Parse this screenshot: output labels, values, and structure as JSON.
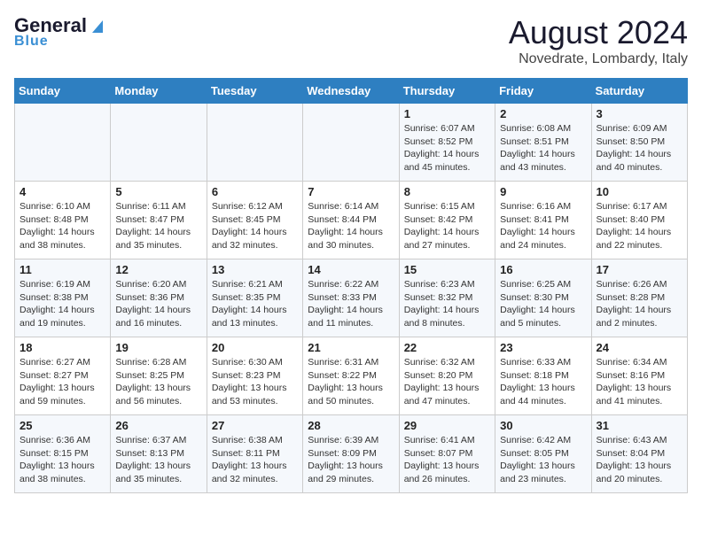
{
  "header": {
    "logo_general": "General",
    "logo_blue": "Blue",
    "title": "August 2024",
    "subtitle": "Novedrate, Lombardy, Italy"
  },
  "days_of_week": [
    "Sunday",
    "Monday",
    "Tuesday",
    "Wednesday",
    "Thursday",
    "Friday",
    "Saturday"
  ],
  "weeks": [
    [
      {
        "day": "",
        "info": ""
      },
      {
        "day": "",
        "info": ""
      },
      {
        "day": "",
        "info": ""
      },
      {
        "day": "",
        "info": ""
      },
      {
        "day": "1",
        "info": "Sunrise: 6:07 AM\nSunset: 8:52 PM\nDaylight: 14 hours\nand 45 minutes."
      },
      {
        "day": "2",
        "info": "Sunrise: 6:08 AM\nSunset: 8:51 PM\nDaylight: 14 hours\nand 43 minutes."
      },
      {
        "day": "3",
        "info": "Sunrise: 6:09 AM\nSunset: 8:50 PM\nDaylight: 14 hours\nand 40 minutes."
      }
    ],
    [
      {
        "day": "4",
        "info": "Sunrise: 6:10 AM\nSunset: 8:48 PM\nDaylight: 14 hours\nand 38 minutes."
      },
      {
        "day": "5",
        "info": "Sunrise: 6:11 AM\nSunset: 8:47 PM\nDaylight: 14 hours\nand 35 minutes."
      },
      {
        "day": "6",
        "info": "Sunrise: 6:12 AM\nSunset: 8:45 PM\nDaylight: 14 hours\nand 32 minutes."
      },
      {
        "day": "7",
        "info": "Sunrise: 6:14 AM\nSunset: 8:44 PM\nDaylight: 14 hours\nand 30 minutes."
      },
      {
        "day": "8",
        "info": "Sunrise: 6:15 AM\nSunset: 8:42 PM\nDaylight: 14 hours\nand 27 minutes."
      },
      {
        "day": "9",
        "info": "Sunrise: 6:16 AM\nSunset: 8:41 PM\nDaylight: 14 hours\nand 24 minutes."
      },
      {
        "day": "10",
        "info": "Sunrise: 6:17 AM\nSunset: 8:40 PM\nDaylight: 14 hours\nand 22 minutes."
      }
    ],
    [
      {
        "day": "11",
        "info": "Sunrise: 6:19 AM\nSunset: 8:38 PM\nDaylight: 14 hours\nand 19 minutes."
      },
      {
        "day": "12",
        "info": "Sunrise: 6:20 AM\nSunset: 8:36 PM\nDaylight: 14 hours\nand 16 minutes."
      },
      {
        "day": "13",
        "info": "Sunrise: 6:21 AM\nSunset: 8:35 PM\nDaylight: 14 hours\nand 13 minutes."
      },
      {
        "day": "14",
        "info": "Sunrise: 6:22 AM\nSunset: 8:33 PM\nDaylight: 14 hours\nand 11 minutes."
      },
      {
        "day": "15",
        "info": "Sunrise: 6:23 AM\nSunset: 8:32 PM\nDaylight: 14 hours\nand 8 minutes."
      },
      {
        "day": "16",
        "info": "Sunrise: 6:25 AM\nSunset: 8:30 PM\nDaylight: 14 hours\nand 5 minutes."
      },
      {
        "day": "17",
        "info": "Sunrise: 6:26 AM\nSunset: 8:28 PM\nDaylight: 14 hours\nand 2 minutes."
      }
    ],
    [
      {
        "day": "18",
        "info": "Sunrise: 6:27 AM\nSunset: 8:27 PM\nDaylight: 13 hours\nand 59 minutes."
      },
      {
        "day": "19",
        "info": "Sunrise: 6:28 AM\nSunset: 8:25 PM\nDaylight: 13 hours\nand 56 minutes."
      },
      {
        "day": "20",
        "info": "Sunrise: 6:30 AM\nSunset: 8:23 PM\nDaylight: 13 hours\nand 53 minutes."
      },
      {
        "day": "21",
        "info": "Sunrise: 6:31 AM\nSunset: 8:22 PM\nDaylight: 13 hours\nand 50 minutes."
      },
      {
        "day": "22",
        "info": "Sunrise: 6:32 AM\nSunset: 8:20 PM\nDaylight: 13 hours\nand 47 minutes."
      },
      {
        "day": "23",
        "info": "Sunrise: 6:33 AM\nSunset: 8:18 PM\nDaylight: 13 hours\nand 44 minutes."
      },
      {
        "day": "24",
        "info": "Sunrise: 6:34 AM\nSunset: 8:16 PM\nDaylight: 13 hours\nand 41 minutes."
      }
    ],
    [
      {
        "day": "25",
        "info": "Sunrise: 6:36 AM\nSunset: 8:15 PM\nDaylight: 13 hours\nand 38 minutes."
      },
      {
        "day": "26",
        "info": "Sunrise: 6:37 AM\nSunset: 8:13 PM\nDaylight: 13 hours\nand 35 minutes."
      },
      {
        "day": "27",
        "info": "Sunrise: 6:38 AM\nSunset: 8:11 PM\nDaylight: 13 hours\nand 32 minutes."
      },
      {
        "day": "28",
        "info": "Sunrise: 6:39 AM\nSunset: 8:09 PM\nDaylight: 13 hours\nand 29 minutes."
      },
      {
        "day": "29",
        "info": "Sunrise: 6:41 AM\nSunset: 8:07 PM\nDaylight: 13 hours\nand 26 minutes."
      },
      {
        "day": "30",
        "info": "Sunrise: 6:42 AM\nSunset: 8:05 PM\nDaylight: 13 hours\nand 23 minutes."
      },
      {
        "day": "31",
        "info": "Sunrise: 6:43 AM\nSunset: 8:04 PM\nDaylight: 13 hours\nand 20 minutes."
      }
    ]
  ]
}
